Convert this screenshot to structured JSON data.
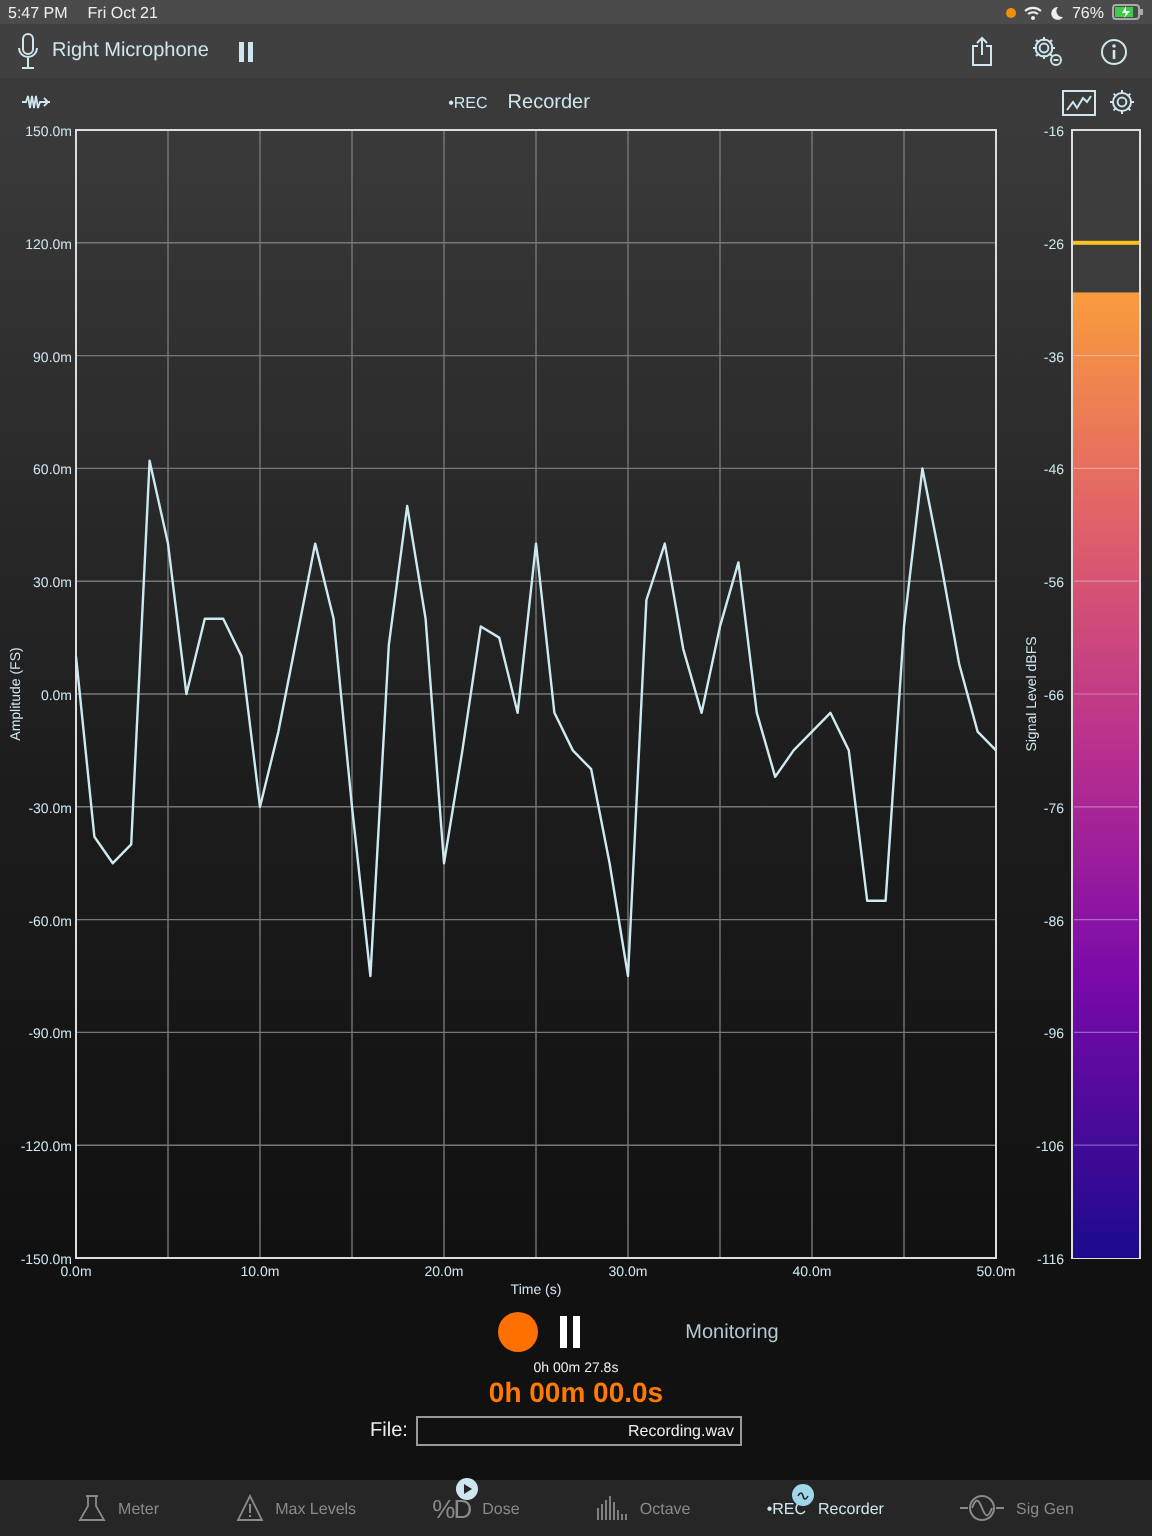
{
  "status_bar": {
    "time": "5:47 PM",
    "date": "Fri Oct 21",
    "battery": "76%"
  },
  "header": {
    "input": "Right Microphone"
  },
  "toolbar": {
    "badge": "•REC",
    "title": "Recorder"
  },
  "chart": {
    "chart_data": {
      "type": "line",
      "grid": true,
      "xlabel": "Time (s)",
      "ylabel": "Amplitude (FS)",
      "x": [
        0,
        1,
        2,
        3,
        4,
        5,
        6,
        7,
        8,
        9,
        10,
        11,
        12,
        13,
        14,
        15,
        16,
        17,
        18,
        19,
        20,
        21,
        22,
        23,
        24,
        25,
        26,
        27,
        28,
        29,
        30,
        31,
        32,
        33,
        34,
        35,
        36,
        37,
        38,
        39,
        40,
        41,
        42,
        43,
        44,
        45,
        46,
        47,
        48,
        49,
        50
      ],
      "series": [
        {
          "color": "#cdeaf3",
          "values": [
            10,
            -38,
            -45,
            -40,
            62,
            40,
            0,
            20,
            20,
            10,
            -30,
            -10,
            15,
            40,
            20,
            -30,
            -75,
            13,
            50,
            20,
            -45,
            -15,
            18,
            15,
            -5,
            40,
            -5,
            -15,
            -20,
            -45,
            -75,
            25,
            40,
            12,
            -5,
            18,
            35,
            -5,
            -22,
            -15,
            -10,
            -5,
            -15,
            -55,
            -55,
            18,
            60,
            35,
            8,
            -10,
            -15
          ]
        }
      ],
      "xlim": [
        0,
        50
      ],
      "ylim": [
        -150,
        150
      ],
      "xticks": [
        {
          "value": 0,
          "label": "0.0m"
        },
        {
          "value": 10,
          "label": "10.0m"
        },
        {
          "value": 20,
          "label": "20.0m"
        },
        {
          "value": 30,
          "label": "30.0m"
        },
        {
          "value": 40,
          "label": "40.0m"
        },
        {
          "value": 50,
          "label": "50.0m"
        }
      ],
      "yticks": [
        {
          "value": 150,
          "label": "150.0m"
        },
        {
          "value": 120,
          "label": "120.0m"
        },
        {
          "value": 90,
          "label": "90.0m"
        },
        {
          "value": 60,
          "label": "60.0m"
        },
        {
          "value": 30,
          "label": "30.0m"
        },
        {
          "value": 0,
          "label": "0.0m"
        },
        {
          "value": -30,
          "label": "-30.0m"
        },
        {
          "value": -60,
          "label": "-60.0m"
        },
        {
          "value": -90,
          "label": "-90.0m"
        },
        {
          "value": -120,
          "label": "-120.0m"
        },
        {
          "value": -150,
          "label": "-150.0m"
        }
      ]
    }
  },
  "meter": {
    "label": "Signal Level dBFS",
    "ticks": [
      "-16",
      "-26",
      "-36",
      "-46",
      "-56",
      "-66",
      "-76",
      "-86",
      "-96",
      "-106",
      "-116"
    ],
    "level": 0.856,
    "peak": {
      "level": 0.9
    }
  },
  "recorder": {
    "status": "Monitoring",
    "elapsed": "0h 00m 27.8s",
    "recorded": "0h 00m 00.0s",
    "file_label": "File:",
    "file_name": "Recording.wav"
  },
  "tabs": [
    {
      "label": "Meter",
      "kind": "flask",
      "selected": false,
      "badge": false
    },
    {
      "label": "Max Levels",
      "kind": "warning",
      "selected": false,
      "badge": false
    },
    {
      "label": "Dose",
      "kind": "text",
      "icon_text": "%D",
      "selected": false,
      "badge": true
    },
    {
      "label": "Octave",
      "kind": "bars",
      "selected": false,
      "badge": false
    },
    {
      "label": "Recorder",
      "kind": "small_text",
      "icon_text": "•REC",
      "selected": true,
      "badge": true
    },
    {
      "label": "Sig Gen",
      "kind": "sine",
      "selected": false,
      "badge": false
    }
  ]
}
